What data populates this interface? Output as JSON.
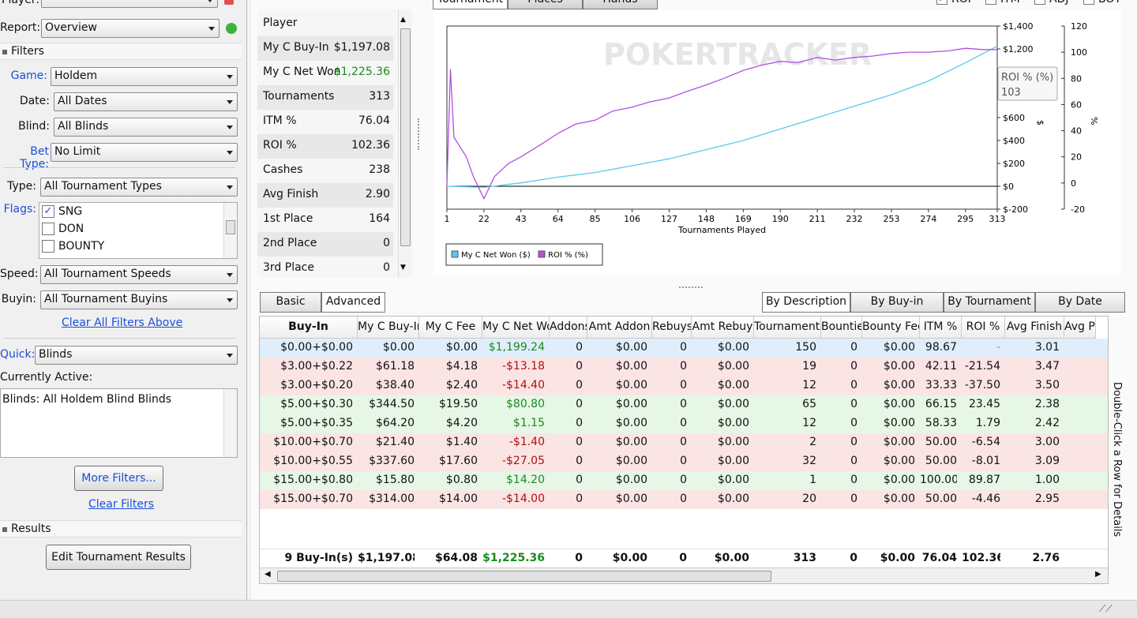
{
  "left": {
    "player_label": "Player:",
    "report_label": "Report:",
    "report_value": "Overview",
    "filters_title": "Filters",
    "game_label": "Game:",
    "game_value": "Holdem",
    "date_label": "Date:",
    "date_value": "All Dates",
    "blind_label": "Blind:",
    "blind_value": "All Blinds",
    "bettype_label": "Bet Type:",
    "bettype_value": "No Limit",
    "type_label": "Type:",
    "type_value": "All Tournament Types",
    "flags_label": "Flags:",
    "flags": [
      {
        "label": "SNG",
        "checked": true
      },
      {
        "label": "DON",
        "checked": false
      },
      {
        "label": "BOUNTY",
        "checked": false
      }
    ],
    "speed_label": "Speed:",
    "speed_value": "All Tournament Speeds",
    "buyin_label": "Buyin:",
    "buyin_value": "All Tournament Buyins",
    "clear_above": "Clear All Filters Above",
    "quick_label": "Quick:",
    "quick_value": "Blinds",
    "currently_active_label": "Currently Active:",
    "active_text": "Blinds: All Holdem Blind Blinds",
    "more_filters": "More Filters...",
    "clear_filters": "Clear Filters",
    "results_title": "Results",
    "edit_results": "Edit Tournament Results"
  },
  "stats": {
    "player_label": "Player",
    "rows": [
      {
        "label": "My C Buy-In",
        "value": "$1,197.08",
        "color": "normal"
      },
      {
        "label": "My C Net Won",
        "value": "$1,225.36",
        "color": "pos"
      },
      {
        "label": "Tournaments",
        "value": "313",
        "color": "normal"
      },
      {
        "label": "ITM %",
        "value": "76.04",
        "color": "normal"
      },
      {
        "label": "ROI %",
        "value": "102.36",
        "color": "normal"
      },
      {
        "label": "Cashes",
        "value": "238",
        "color": "normal"
      },
      {
        "label": "Avg Finish",
        "value": "2.90",
        "color": "normal"
      },
      {
        "label": "1st Place",
        "value": "164",
        "color": "normal"
      },
      {
        "label": "2nd Place",
        "value": "0",
        "color": "normal"
      },
      {
        "label": "3rd Place",
        "value": "0",
        "color": "normal"
      }
    ]
  },
  "top_tabs": [
    "Tournament",
    "Places",
    "Hands"
  ],
  "top_checks": [
    {
      "label": "ROI",
      "checked": true
    },
    {
      "label": "ITM",
      "checked": false
    },
    {
      "label": "ADJ",
      "checked": false
    },
    {
      "label": "BOT",
      "checked": false
    }
  ],
  "chart_data": {
    "type": "line",
    "watermark": "POKERTRACKER",
    "xlabel": "Tournaments Played",
    "x_ticks": [
      "1",
      "22",
      "43",
      "64",
      "85",
      "106",
      "127",
      "148",
      "169",
      "190",
      "211",
      "232",
      "253",
      "274",
      "295",
      "313"
    ],
    "xlim": [
      1,
      313
    ],
    "y_left_ticks": [
      "$1,400",
      "$1,200",
      "$1,000",
      "$800",
      "$600",
      "$400",
      "$200",
      "$0",
      "$-200"
    ],
    "y_left_label": "$",
    "ylim_left": [
      -200,
      1400
    ],
    "y_right_ticks": [
      "120",
      "100",
      "80",
      "60",
      "40",
      "20",
      "0",
      "-20"
    ],
    "y_right_label": "%",
    "ylim_right": [
      -20,
      120
    ],
    "series": [
      {
        "name": "My C Net Won ($)",
        "color": "#5bc8f0",
        "axis": "left",
        "points": [
          [
            1,
            0
          ],
          [
            22,
            -10
          ],
          [
            43,
            30
          ],
          [
            64,
            80
          ],
          [
            85,
            120
          ],
          [
            106,
            180
          ],
          [
            127,
            240
          ],
          [
            148,
            320
          ],
          [
            169,
            400
          ],
          [
            190,
            500
          ],
          [
            211,
            600
          ],
          [
            232,
            700
          ],
          [
            253,
            800
          ],
          [
            274,
            920
          ],
          [
            295,
            1080
          ],
          [
            313,
            1225
          ]
        ]
      },
      {
        "name": "ROI % (%)",
        "color": "#b44fe0",
        "axis": "right",
        "points": [
          [
            1,
            -2
          ],
          [
            3,
            87
          ],
          [
            5,
            35
          ],
          [
            12,
            20
          ],
          [
            16,
            5
          ],
          [
            22,
            -12
          ],
          [
            28,
            5
          ],
          [
            36,
            15
          ],
          [
            43,
            20
          ],
          [
            55,
            30
          ],
          [
            64,
            38
          ],
          [
            74,
            45
          ],
          [
            85,
            48
          ],
          [
            95,
            55
          ],
          [
            106,
            58
          ],
          [
            116,
            62
          ],
          [
            127,
            65
          ],
          [
            137,
            70
          ],
          [
            148,
            75
          ],
          [
            158,
            80
          ],
          [
            169,
            86
          ],
          [
            179,
            90
          ],
          [
            190,
            93
          ],
          [
            200,
            92
          ],
          [
            211,
            96
          ],
          [
            221,
            94
          ],
          [
            232,
            96
          ],
          [
            242,
            97
          ],
          [
            253,
            99
          ],
          [
            263,
            100
          ],
          [
            274,
            100
          ],
          [
            285,
            101
          ],
          [
            295,
            103
          ],
          [
            305,
            102
          ],
          [
            313,
            102
          ]
        ]
      }
    ],
    "tooltip_label": "ROI % (%)",
    "tooltip_value": "103",
    "legend_placement": "bottom-left"
  },
  "view_tabs": [
    "Basic",
    "Advanced"
  ],
  "by_tabs": [
    "By Description",
    "By Buy-in",
    "By Tournament",
    "By Date"
  ],
  "table": {
    "columns": [
      "Buy-In",
      "My C Buy-In",
      "My C Fee",
      "My C Net Won",
      "Addons",
      "Amt Addon",
      "Rebuys",
      "Amt Rebuy",
      "Tournaments",
      "Bounties",
      "Bounty Fee",
      "ITM %",
      "ROI %",
      "Avg Finish",
      "Avg Place"
    ],
    "rows": [
      {
        "cells": [
          "$0.00+$0.00",
          "$0.00",
          "$0.00",
          "$1,199.24",
          "0",
          "$0.00",
          "0",
          "$0.00",
          "150",
          "0",
          "$0.00",
          "98.67",
          "-",
          "3.01",
          ""
        ],
        "net": "pos",
        "bg": "#dfeefa"
      },
      {
        "cells": [
          "$3.00+$0.22",
          "$61.18",
          "$4.18",
          "-$13.18",
          "0",
          "$0.00",
          "0",
          "$0.00",
          "19",
          "0",
          "$0.00",
          "42.11",
          "-21.54",
          "3.47",
          ""
        ],
        "net": "neg",
        "bg": "#fbe4e4"
      },
      {
        "cells": [
          "$3.00+$0.20",
          "$38.40",
          "$2.40",
          "-$14.40",
          "0",
          "$0.00",
          "0",
          "$0.00",
          "12",
          "0",
          "$0.00",
          "33.33",
          "-37.50",
          "3.50",
          ""
        ],
        "net": "neg",
        "bg": "#fbe4e4"
      },
      {
        "cells": [
          "$5.00+$0.30",
          "$344.50",
          "$19.50",
          "$80.80",
          "0",
          "$0.00",
          "0",
          "$0.00",
          "65",
          "0",
          "$0.00",
          "66.15",
          "23.45",
          "2.38",
          ""
        ],
        "net": "pos",
        "bg": "#e6f7e6"
      },
      {
        "cells": [
          "$5.00+$0.35",
          "$64.20",
          "$4.20",
          "$1.15",
          "0",
          "$0.00",
          "0",
          "$0.00",
          "12",
          "0",
          "$0.00",
          "58.33",
          "1.79",
          "2.42",
          ""
        ],
        "net": "pos",
        "bg": "#e6f7e6"
      },
      {
        "cells": [
          "$10.00+$0.70",
          "$21.40",
          "$1.40",
          "-$1.40",
          "0",
          "$0.00",
          "0",
          "$0.00",
          "2",
          "0",
          "$0.00",
          "50.00",
          "-6.54",
          "3.00",
          ""
        ],
        "net": "neg",
        "bg": "#fbe4e4"
      },
      {
        "cells": [
          "$10.00+$0.55",
          "$337.60",
          "$17.60",
          "-$27.05",
          "0",
          "$0.00",
          "0",
          "$0.00",
          "32",
          "0",
          "$0.00",
          "50.00",
          "-8.01",
          "3.09",
          ""
        ],
        "net": "neg",
        "bg": "#fbe4e4"
      },
      {
        "cells": [
          "$15.00+$0.80",
          "$15.80",
          "$0.80",
          "$14.20",
          "0",
          "$0.00",
          "0",
          "$0.00",
          "1",
          "0",
          "$0.00",
          "100.00",
          "89.87",
          "1.00",
          ""
        ],
        "net": "pos",
        "bg": "#e6f7e6"
      },
      {
        "cells": [
          "$15.00+$0.70",
          "$314.00",
          "$14.00",
          "-$14.00",
          "0",
          "$0.00",
          "0",
          "$0.00",
          "20",
          "0",
          "$0.00",
          "50.00",
          "-4.46",
          "2.95",
          ""
        ],
        "net": "neg",
        "bg": "#fbe4e4"
      }
    ],
    "totals": [
      "9 Buy-In(s)",
      "$1,197.08",
      "$64.08",
      "$1,225.36",
      "0",
      "$0.00",
      "0",
      "$0.00",
      "313",
      "0",
      "$0.00",
      "76.04",
      "102.36",
      "2.76",
      ""
    ],
    "side_hint": "Double-Click a Row for Details"
  }
}
